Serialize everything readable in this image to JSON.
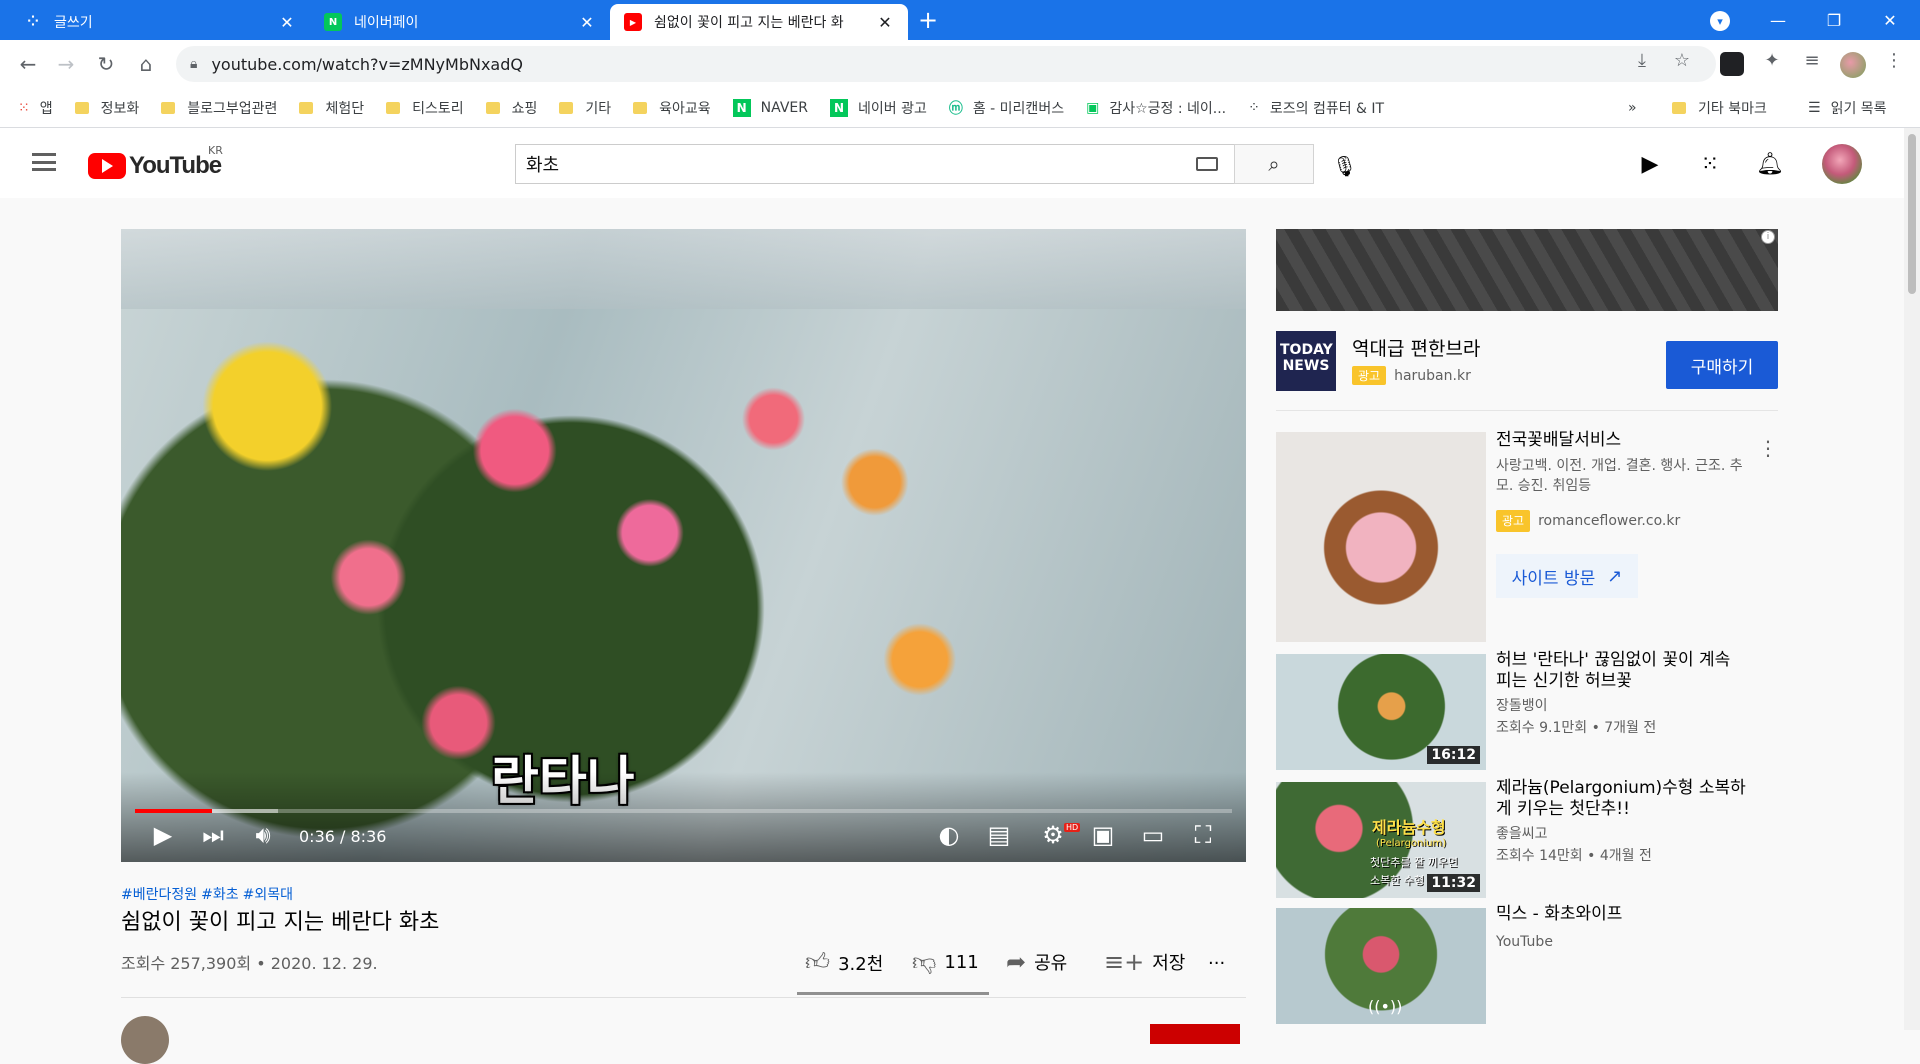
{
  "browser": {
    "tabs": [
      {
        "title": "글쓰기",
        "favicon": "tistory-icon"
      },
      {
        "title": "네이버페이",
        "favicon": "naverpay-icon"
      },
      {
        "title": "쉼없이 꽃이 피고 지는 베란다 화",
        "favicon": "youtube-icon",
        "active": true
      }
    ],
    "new_tab_label": "+",
    "url": "youtube.com/watch?v=zMNyMbNxadQ",
    "accent_color": "#1a73e8"
  },
  "bookmarks": {
    "items": [
      {
        "label": "앱",
        "type": "apps"
      },
      {
        "label": "정보화",
        "type": "folder"
      },
      {
        "label": "블로그부업관련",
        "type": "folder"
      },
      {
        "label": "체험단",
        "type": "folder"
      },
      {
        "label": "티스토리",
        "type": "folder"
      },
      {
        "label": "쇼핑",
        "type": "folder"
      },
      {
        "label": "기타",
        "type": "folder"
      },
      {
        "label": "육아교육",
        "type": "folder"
      },
      {
        "label": "NAVER",
        "type": "naver"
      },
      {
        "label": "네이버 광고",
        "type": "naver"
      },
      {
        "label": "홈 - 미리캔버스",
        "type": "site"
      },
      {
        "label": "감사☆긍정 : 네이...",
        "type": "blog"
      },
      {
        "label": "로즈의 컴퓨터 & IT",
        "type": "site"
      }
    ],
    "overflow": "»",
    "other_bookmarks": "기타 북마크",
    "reading_list": "읽기 목록"
  },
  "youtube": {
    "logo_text": "YouTube",
    "region": "KR",
    "search_value": "화초",
    "brand_color": "#ff0000"
  },
  "player": {
    "subtitle": "란타나",
    "current_time": "0:36",
    "duration": "8:36",
    "time_display": "0:36 / 8:36",
    "played_fraction": 0.0698,
    "buffered_fraction": 0.13,
    "hd_badge": "HD"
  },
  "video": {
    "hashtags": [
      "#베란다정원",
      "#화초",
      "#외목대"
    ],
    "title": "쉼없이 꽃이 피고 지는 베란다 화초",
    "views_date": "조회수 257,390회 • 2020. 12. 29.",
    "likes": "3.2천",
    "dislikes": "111",
    "share_label": "공유",
    "save_label": "저장",
    "more_label": "..."
  },
  "sidebar": {
    "banner_ad": {
      "logo_line1": "TODAY",
      "logo_line2": "NEWS",
      "title": "역대급 편한브라",
      "badge": "광고",
      "domain": "haruban.kr",
      "cta": "구매하기"
    },
    "promo": {
      "title": "전국꽃배달서비스",
      "description": "사랑고백. 이전. 개업. 결혼. 행사. 근조. 추모. 승진. 취임등",
      "badge": "광고",
      "domain": "romanceflower.co.kr",
      "cta": "사이트 방문"
    },
    "videos": [
      {
        "title": "허브 '란타나' 끊임없이 꽃이 계속 피는 신기한 허브꽃",
        "channel": "장돌뱅이",
        "meta": "조회수 9.1만회 • 7개월 전",
        "duration": "16:12"
      },
      {
        "title": "제라늄(Pelargonium)수형 소복하게 키우는 첫단추!!",
        "channel": "좋을씨고",
        "meta": "조회수 14만회 • 4개월 전",
        "duration": "11:32",
        "thumb_text1": "제라늄수형",
        "thumb_text2": "(Pelargonium)",
        "thumb_text3": "첫단추를 잘 끼우면",
        "thumb_text4": "소복한 수형"
      },
      {
        "title": "믹스 - 화초와이프",
        "channel": "YouTube",
        "meta": "",
        "duration": ""
      }
    ]
  }
}
